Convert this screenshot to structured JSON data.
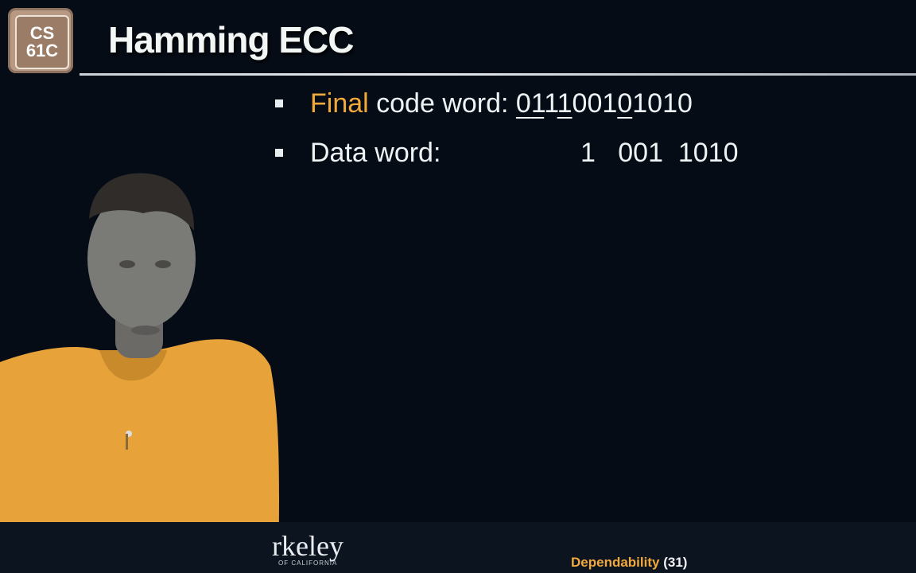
{
  "logo": {
    "line1": "CS",
    "line2": "61C"
  },
  "slide": {
    "title": "Hamming ECC"
  },
  "bullets": [
    {
      "accent": "Final",
      "label": " code word: ",
      "bits": [
        "0",
        "1",
        "1",
        "1",
        "0",
        "0",
        "1",
        "0",
        "1",
        "0",
        "1",
        "0"
      ],
      "underlined_positions": [
        1,
        2,
        4,
        8
      ]
    },
    {
      "label": "Data word:",
      "value": "1   001  1010"
    }
  ],
  "branding": {
    "university": "rkeley",
    "tagline": "OF CALIFORNIA"
  },
  "footer": {
    "topic": "Dependability",
    "page": "(31)"
  },
  "colors": {
    "background": "#060c16",
    "accent": "#f2a93b",
    "text": "#eef3f6",
    "presenter_shirt": "#e8a23a"
  }
}
